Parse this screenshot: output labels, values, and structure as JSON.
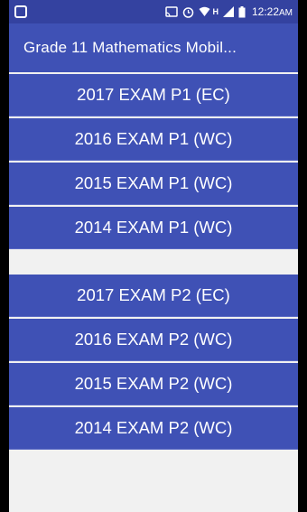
{
  "status_bar": {
    "time": "12:22",
    "time_suffix": "AM",
    "network_label": "H",
    "icons": [
      "notification-icon",
      "cast-icon",
      "alarm-icon",
      "wifi-icon",
      "signal-icon",
      "battery-icon"
    ]
  },
  "toolbar": {
    "title": "Grade 11 Mathematics Mobil..."
  },
  "paper1": {
    "items": [
      {
        "label": "2017 EXAM P1 (EC)"
      },
      {
        "label": "2016 EXAM P1 (WC)"
      },
      {
        "label": "2015 EXAM P1 (WC)"
      },
      {
        "label": "2014 EXAM P1 (WC)"
      }
    ]
  },
  "paper2": {
    "items": [
      {
        "label": "2017 EXAM P2 (EC)"
      },
      {
        "label": "2016 EXAM P2 (WC)"
      },
      {
        "label": "2015 EXAM P2 (WC)"
      },
      {
        "label": "2014 EXAM P2 (WC)"
      }
    ]
  },
  "colors": {
    "primary": "#3f51b5",
    "primary_dark": "#3442a0",
    "background": "#f1f1f1",
    "text_on_primary": "#ffffff"
  }
}
